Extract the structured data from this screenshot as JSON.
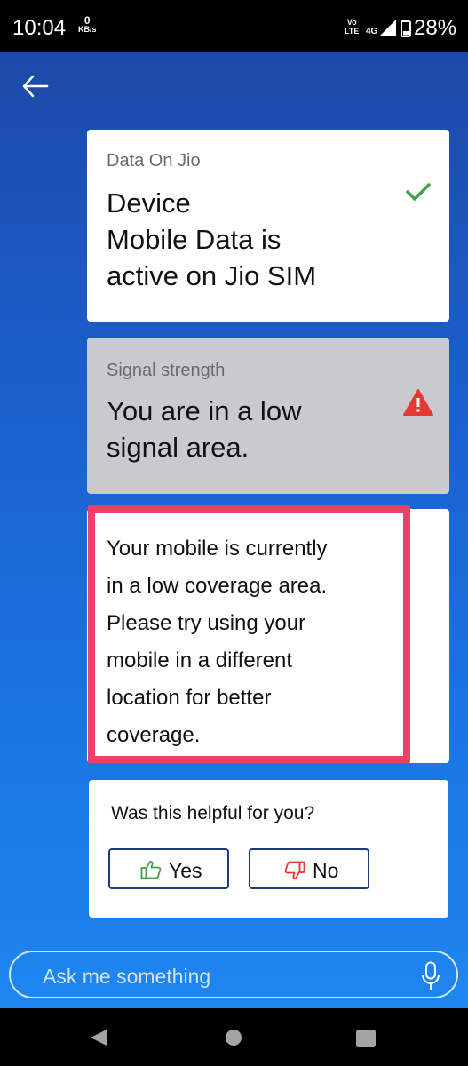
{
  "status_bar": {
    "time": "10:04",
    "net_speed_value": "0",
    "net_speed_unit": "KB/s",
    "volte_top": "Vo",
    "volte_bottom": "LTE",
    "network": "4G",
    "battery": "28%"
  },
  "colors": {
    "accent": "#1a5fcc",
    "highlight_border": "#f03e6a",
    "check": "#43a047",
    "warning": "#e53935"
  },
  "data_card": {
    "caption": "Data On Jio",
    "title_line1": "Device",
    "title_line2": "Mobile Data is",
    "title_line3": "active on Jio SIM",
    "status_icon": "check-icon"
  },
  "signal_card": {
    "caption": "Signal strength",
    "title_line1": "You are in a low",
    "title_line2": "signal area.",
    "status_icon": "warning-icon"
  },
  "coverage_card": {
    "line1": "Your mobile is currently",
    "line2": "in a low coverage area.",
    "line3": "Please try using your",
    "line4": "mobile in a different",
    "line5": "location for better",
    "line6": "coverage."
  },
  "feedback": {
    "question": "Was this helpful for you?",
    "yes_label": "Yes",
    "no_label": "No"
  },
  "ask": {
    "placeholder": "Ask me something"
  }
}
